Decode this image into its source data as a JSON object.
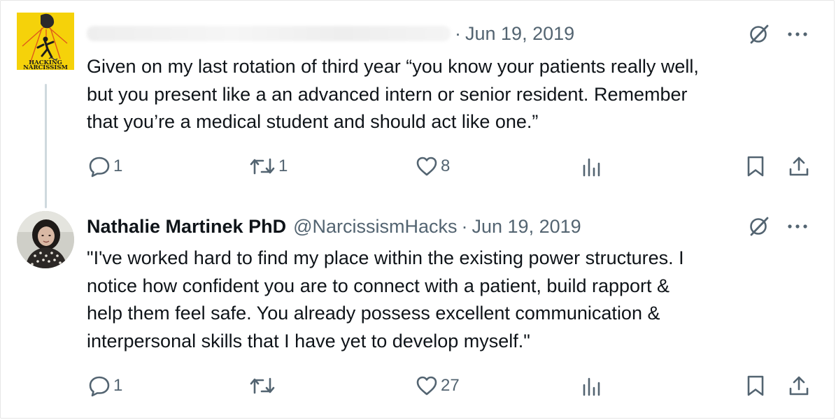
{
  "tweets": [
    {
      "display_name": "",
      "handle": "",
      "separator": "·",
      "date": "Jun 19, 2019",
      "avatar_text_1": "HACKING",
      "avatar_text_2": "NARCISSISM",
      "text": "Given on my last rotation of third year “you know your patients really well,\nbut you present like a an advanced intern or senior resident. Remember\nthat you’re a medical student and should act like one.”",
      "replies": "1",
      "retweets": "1",
      "likes": "8",
      "views": ""
    },
    {
      "display_name": "Nathalie Martinek PhD",
      "handle": "@NarcissismHacks",
      "separator": "·",
      "date": "Jun 19, 2019",
      "text": "\"I've worked hard to find my place within the existing power structures. I\nnotice how confident you are to connect with a patient, build rapport &\nhelp them feel safe. You already possess excellent communication &\ninterpersonal skills that I have yet to develop myself.\"",
      "replies": "1",
      "retweets": "",
      "likes": "27",
      "views": ""
    }
  ],
  "icons": {
    "grok": "grok-icon",
    "more": "more-options-icon",
    "reply": "reply-icon",
    "retweet": "retweet-icon",
    "like": "like-icon",
    "views": "views-icon",
    "bookmark": "bookmark-icon",
    "share": "share-icon"
  },
  "colors": {
    "text_primary": "#0f1419",
    "text_secondary": "#536471",
    "thread_line": "#cfd9de",
    "avatar_yellow": "#f5d20a"
  }
}
